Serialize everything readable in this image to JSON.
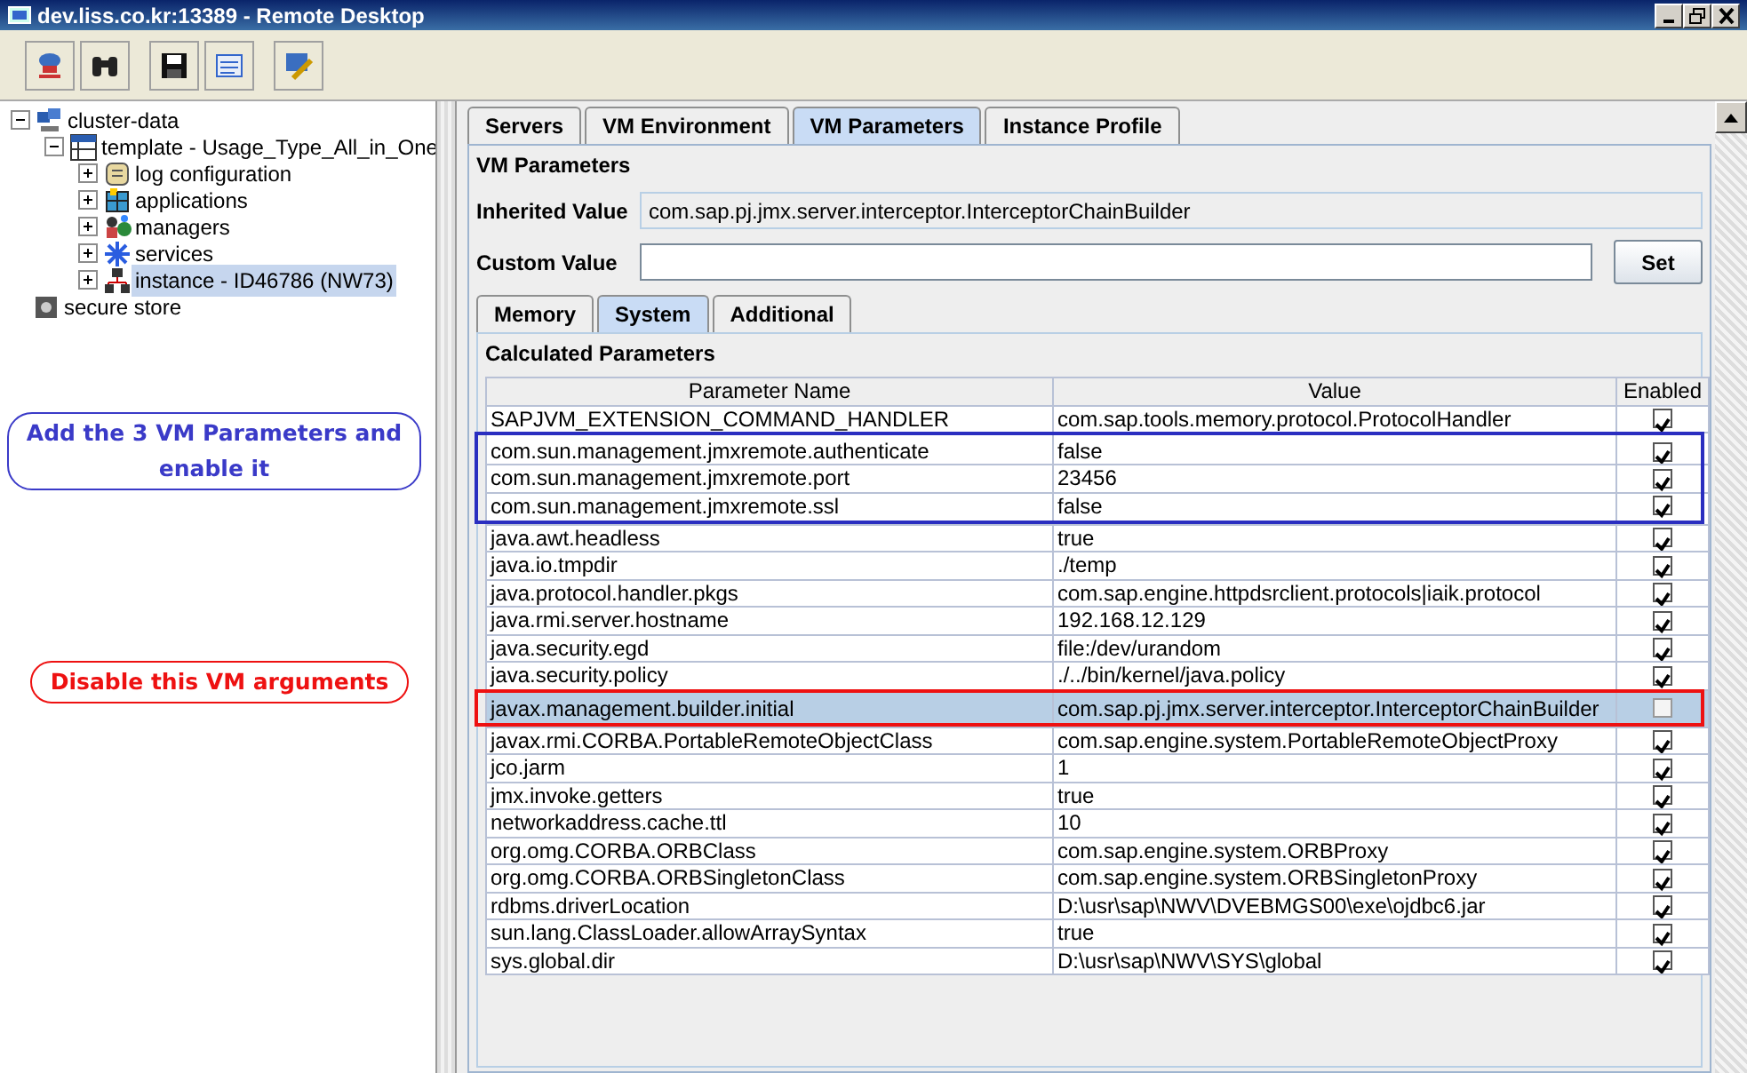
{
  "window": {
    "title": "dev.liss.co.kr:13389 - Remote Desktop"
  },
  "toolbar": {
    "buttons": [
      {
        "kind": "connect"
      },
      {
        "kind": "find"
      },
      {
        "kind": "save"
      },
      {
        "kind": "xml"
      },
      {
        "kind": "edit"
      }
    ]
  },
  "tree": [
    {
      "label": "cluster-data",
      "expanded": true,
      "selected": false,
      "children": [
        {
          "label": "template - Usage_Type_All_in_One",
          "expanded": true,
          "selected": false,
          "children": [
            {
              "label": "log configuration",
              "expanded": false,
              "selected": false
            },
            {
              "label": "applications",
              "expanded": false,
              "selected": false
            },
            {
              "label": "managers",
              "expanded": false,
              "selected": false
            },
            {
              "label": "services",
              "expanded": false,
              "selected": false
            },
            {
              "label": "instance - ID46786 (NW73)",
              "expanded": false,
              "selected": true
            }
          ]
        }
      ]
    },
    {
      "label": "secure store",
      "selected": false
    }
  ],
  "callouts": [
    {
      "text": "Add the 3 VM Parameters and enable it",
      "color": "#3a3ac8"
    },
    {
      "text": "Disable this VM arguments",
      "color": "#ee1111"
    }
  ],
  "tabs": [
    {
      "label": "Servers",
      "selected": false
    },
    {
      "label": "VM Environment",
      "selected": false
    },
    {
      "label": "VM Parameters",
      "selected": true
    },
    {
      "label": "Instance Profile",
      "selected": false
    }
  ],
  "vm_parameters": {
    "title": "VM Parameters",
    "inherited_label": "Inherited Value",
    "inherited_value": "com.sap.pj.jmx.server.interceptor.InterceptorChainBuilder",
    "custom_label": "Custom Value",
    "set_button": "Set"
  },
  "sub_tabs": [
    {
      "label": "Memory",
      "selected": false
    },
    {
      "label": "System",
      "selected": true
    },
    {
      "label": "Additional",
      "selected": false
    }
  ],
  "calculated": {
    "title": "Calculated Parameters",
    "columns": [
      "Parameter Name",
      "Value",
      "Enabled"
    ],
    "rows": [
      {
        "name": "SAPJVM_EXTENSION_COMMAND_HANDLER",
        "value": "com.sap.tools.memory.protocol.ProtocolHandler",
        "enabled": true,
        "selected": false
      },
      {
        "name": "com.sun.management.jmxremote.authenticate",
        "value": "false",
        "enabled": true,
        "selected": false,
        "color": "#2a2ec0"
      },
      {
        "name": "com.sun.management.jmxremote.port",
        "value": "23456",
        "enabled": true,
        "selected": false,
        "color": "#2a2ec0"
      },
      {
        "name": "com.sun.management.jmxremote.ssl",
        "value": "false",
        "enabled": true,
        "selected": false,
        "color": "#2a2ec0"
      },
      {
        "name": "java.awt.headless",
        "value": "true",
        "enabled": true,
        "selected": false
      },
      {
        "name": "java.io.tmpdir",
        "value": "./temp",
        "enabled": true,
        "selected": false
      },
      {
        "name": "java.protocol.handler.pkgs",
        "value": "com.sap.engine.httpdsrclient.protocols|iaik.protocol",
        "enabled": true,
        "selected": false
      },
      {
        "name": "java.rmi.server.hostname",
        "value": "192.168.12.129",
        "enabled": true,
        "selected": false
      },
      {
        "name": "java.security.egd",
        "value": "file:/dev/urandom",
        "enabled": true,
        "selected": false
      },
      {
        "name": "java.security.policy",
        "value": "./../bin/kernel/java.policy",
        "enabled": true,
        "selected": false
      },
      {
        "name": "javax.management.builder.initial",
        "value": "com.sap.pj.jmx.server.interceptor.InterceptorChainBuilder",
        "enabled": false,
        "selected": true,
        "color": "#ee1111"
      },
      {
        "name": "javax.rmi.CORBA.PortableRemoteObjectClass",
        "value": "com.sap.engine.system.PortableRemoteObjectProxy",
        "enabled": true,
        "selected": false
      },
      {
        "name": "jco.jarm",
        "value": "1",
        "enabled": true,
        "selected": false
      },
      {
        "name": "jmx.invoke.getters",
        "value": "true",
        "enabled": true,
        "selected": false
      },
      {
        "name": "networkaddress.cache.ttl",
        "value": "10",
        "enabled": true,
        "selected": false
      },
      {
        "name": "org.omg.CORBA.ORBClass",
        "value": "com.sap.engine.system.ORBProxy",
        "enabled": true,
        "selected": false
      },
      {
        "name": "org.omg.CORBA.ORBSingletonClass",
        "value": "com.sap.engine.system.ORBSingletonProxy",
        "enabled": true,
        "selected": false
      },
      {
        "name": "rdbms.driverLocation",
        "value": "D:\\usr\\sap\\NWV\\DVEBMGS00\\exe\\ojdbc6.jar",
        "enabled": true,
        "selected": false
      },
      {
        "name": "sun.lang.ClassLoader.allowArraySyntax",
        "value": "true",
        "enabled": true,
        "selected": false
      },
      {
        "name": "sys.global.dir",
        "value": "D:\\usr\\sap\\NWV\\SYS\\global",
        "enabled": true,
        "selected": false
      }
    ]
  }
}
